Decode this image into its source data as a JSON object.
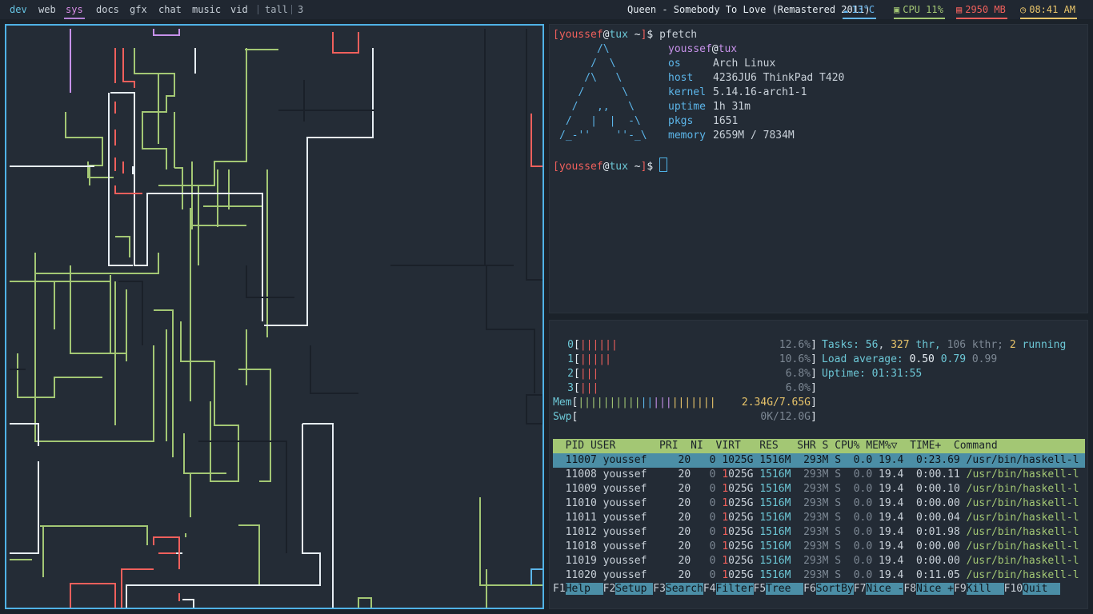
{
  "bar": {
    "workspaces": [
      "dev",
      "web",
      "sys",
      "docs",
      "gfx",
      "chat",
      "music",
      "vid"
    ],
    "layout": "tall",
    "window_count": "3",
    "now_playing": "Queen - Somebody To Love (Remastered 2011)",
    "weather": "13°C",
    "cpu": "CPU 11%",
    "mem": "2950 MB",
    "time": "08:41 AM",
    "colors": {
      "weather": "#66b7f0",
      "cpu": "#a3c774",
      "mem": "#f0605c",
      "time": "#e8c46a"
    }
  },
  "terminal": {
    "prompt_user": "youssef",
    "prompt_host": "tux",
    "prompt_dir": "~",
    "command": "pfetch",
    "fetch": {
      "user": "youssef",
      "host": "tux",
      "rows": [
        {
          "k": "os",
          "v": "Arch Linux"
        },
        {
          "k": "host",
          "v": "4236JU6 ThinkPad T420"
        },
        {
          "k": "kernel",
          "v": "5.14.16-arch1-1"
        },
        {
          "k": "uptime",
          "v": "1h 31m"
        },
        {
          "k": "pkgs",
          "v": "1651"
        },
        {
          "k": "memory",
          "v": "2659M / 7834M"
        }
      ],
      "logo": [
        "      /\\      ",
        "     /  \\     ",
        "    /\\   \\    ",
        "   /      \\   ",
        "  /   ,,   \\  ",
        " /   |  |  -\\ ",
        "/_-''    ''-_\\"
      ]
    }
  },
  "htop": {
    "cpus": [
      {
        "id": "0",
        "bars": "||||||",
        "pct": "12.6%"
      },
      {
        "id": "1",
        "bars": "|||||",
        "pct": "10.6%"
      },
      {
        "id": "2",
        "bars": "|||",
        "pct": "6.8%"
      },
      {
        "id": "3",
        "bars": "|||",
        "pct": "6.0%"
      }
    ],
    "mem": {
      "label": "Mem",
      "bars": "||||||||||||||||||||||",
      "value": "2.34G/7.65G"
    },
    "swp": {
      "label": "Swp",
      "value": "0K/12.0G"
    },
    "tasks": {
      "label": "Tasks:",
      "tasks": "56",
      "thr": "327",
      "thr_label": "thr,",
      "kthr": "106 kthr;",
      "running": "2",
      "running_label": "running"
    },
    "load": {
      "label": "Load average:",
      "l1": "0.50",
      "l5": "0.79",
      "l15": "0.99"
    },
    "uptime": {
      "label": "Uptime:",
      "value": "01:31:55"
    },
    "header": "  PID USER       PRI  NI  VIRT   RES   SHR S CPU% MEM%▽  TIME+  Command",
    "rows": [
      {
        "pid": "11007",
        "time": "0:23.69"
      },
      {
        "pid": "11008",
        "time": "0:00.11"
      },
      {
        "pid": "11009",
        "time": "0:00.10"
      },
      {
        "pid": "11010",
        "time": "0:00.00"
      },
      {
        "pid": "11011",
        "time": "0:00.04"
      },
      {
        "pid": "11012",
        "time": "0:01.98"
      },
      {
        "pid": "11018",
        "time": "0:00.00"
      },
      {
        "pid": "11019",
        "time": "0:00.00"
      },
      {
        "pid": "11020",
        "time": "0:11.05"
      }
    ],
    "row_common": {
      "user": "youssef",
      "pri": "20",
      "ni": "0",
      "virt": "1025G",
      "res": "1516M",
      "shr": "293M",
      "s": "S",
      "cpu": "0.0",
      "mem": "19.4",
      "cmd": "/usr/bin/haskell-l"
    },
    "fkeys": [
      {
        "k": "F1",
        "l": "Help  "
      },
      {
        "k": "F2",
        "l": "Setup "
      },
      {
        "k": "F3",
        "l": "Search"
      },
      {
        "k": "F4",
        "l": "Filter"
      },
      {
        "k": "F5",
        "l": "Tree  "
      },
      {
        "k": "F6",
        "l": "SortBy"
      },
      {
        "k": "F7",
        "l": "Nice -"
      },
      {
        "k": "F8",
        "l": "Nice +"
      },
      {
        "k": "F9",
        "l": "Kill  "
      },
      {
        "k": "F10",
        "l": "Quit  "
      }
    ]
  }
}
